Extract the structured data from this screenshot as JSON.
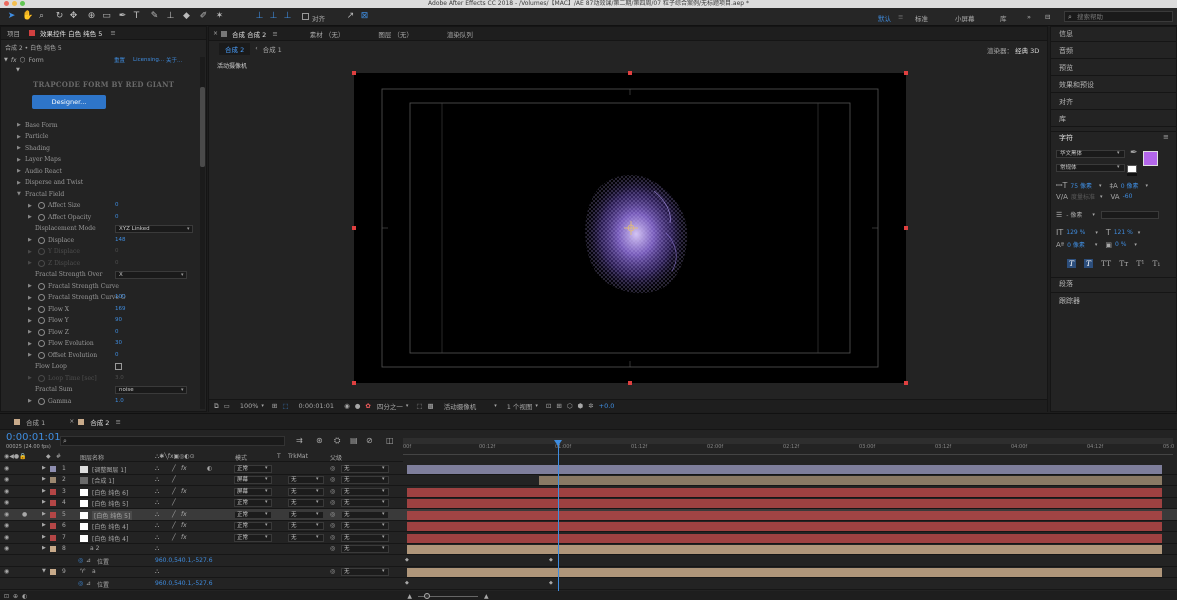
{
  "window_title": "Adobe After Effects CC 2018 - /Volumes/【MAC】/AE 87动效课/第二期/第四周/07 粒子综合案例/无标题项目.aep *",
  "toolbar": {
    "align_label": "对齐",
    "workspaces": [
      "默认",
      "标准",
      "小屏幕",
      "库"
    ],
    "search_placeholder": "搜索帮助"
  },
  "left_panel": {
    "tabs": [
      "项目",
      "效果控件 白色 纯色 5"
    ],
    "breadcrumb": "合成 2 • 白色 纯色 5",
    "effect_name": "Form",
    "effect_links": [
      "重置",
      "Licensing...",
      "关于..."
    ],
    "logo_text": "TRAPCODE FORM BY RED GIANT",
    "designer_button": "Designer...",
    "groups": [
      "Base Form",
      "Particle",
      "Shading",
      "Layer Maps",
      "Audio React",
      "Disperse and Twist",
      "Fractal Field"
    ],
    "params": [
      {
        "label": "Affect Size",
        "value": "0"
      },
      {
        "label": "Affect Opacity",
        "value": "0"
      },
      {
        "label": "Displacement Mode",
        "value": "XYZ Linked"
      },
      {
        "label": "Displace",
        "value": "148"
      },
      {
        "label": "Y Displace",
        "value": "0"
      },
      {
        "label": "Z Displace",
        "value": "0"
      },
      {
        "label": "Fractal Strength Over",
        "value": "X"
      },
      {
        "label": "Fractal Strength Curve",
        "value": ""
      },
      {
        "label": "Fractal Strength Curve O",
        "value": "100"
      },
      {
        "label": "Flow X",
        "value": "169"
      },
      {
        "label": "Flow Y",
        "value": "90"
      },
      {
        "label": "Flow Z",
        "value": "0"
      },
      {
        "label": "Flow Evolution",
        "value": "30"
      },
      {
        "label": "Offset Evolution",
        "value": "0"
      },
      {
        "label": "Flow Loop",
        "value": ""
      },
      {
        "label": "Loop Time [sec]",
        "value": "3.0"
      },
      {
        "label": "Fractal Sum",
        "value": "noise"
      },
      {
        "label": "Gamma",
        "value": "1.0"
      }
    ]
  },
  "comp_panel": {
    "tabs": [
      "合成 合成 2",
      "素材 （无）",
      "图层 （无）",
      "渲染队列"
    ],
    "breadcrumbs": [
      "合成 2",
      "合成 1"
    ],
    "renderer": "渲染器：",
    "renderer_value": "经典 3D",
    "camera_label": "活动摄像机",
    "footer": {
      "zoom": "100%",
      "timecode": "0:00:01:01",
      "resolution": "四分之一",
      "camera": "活动摄像机",
      "views": "1 个视图",
      "exposure": "+0.0"
    }
  },
  "right_panel": {
    "links": [
      "信息",
      "音频",
      "预览",
      "效果和预设",
      "对齐",
      "库"
    ],
    "char_title": "字符",
    "font_family": "华文黑体",
    "font_style": "常规体",
    "font_size": "75 像素",
    "leading": "0 像素",
    "kerning": "度量标准",
    "tracking": "-60",
    "stroke": "- 像素",
    "vscale": "129 %",
    "hscale": "121 %",
    "baseline": "0 像素",
    "tsume": "0 %",
    "text_styles": [
      "T",
      "T",
      "TT",
      "Tт",
      "T¹",
      "T₁"
    ],
    "bottom_links": [
      "段落",
      "跟踪器"
    ],
    "fill_color": "#b366ea"
  },
  "timeline": {
    "tabs": [
      "合成 1",
      "合成 2"
    ],
    "timecode": "0:00:01:01",
    "fps": "00025 (24.00 fps)",
    "headers": {
      "name": "图层名称",
      "mode": "模式",
      "t": "T",
      "trkmat": "TrkMat",
      "parent": "父级"
    },
    "ruler": [
      "00f",
      "00:12f",
      "01:00f",
      "01:12f",
      "02:00f",
      "02:12f",
      "03:00f",
      "03:12f",
      "04:00f",
      "04:12f",
      "05:0"
    ],
    "layers": [
      {
        "num": "1",
        "name": "[调整图层 1]",
        "mode": "正常",
        "trkmat": "",
        "parent": "无",
        "color": "#8e8eb0",
        "bar_start": 0.0
      },
      {
        "num": "2",
        "name": "[合成 1]",
        "mode": "屏幕",
        "trkmat": "无",
        "parent": "无",
        "color": "#9c8870",
        "bar_start": 0.175
      },
      {
        "num": "3",
        "name": "[白色 纯色 6]",
        "mode": "屏幕",
        "trkmat": "无",
        "parent": "无",
        "color": "#b44646",
        "bar_start": 0.0
      },
      {
        "num": "4",
        "name": "[白色 纯色 5]",
        "mode": "正常",
        "trkmat": "无",
        "parent": "无",
        "color": "#b44646",
        "bar_start": 0.0
      },
      {
        "num": "5",
        "name": "[白色 纯色 5]",
        "mode": "正常",
        "trkmat": "无",
        "parent": "无",
        "color": "#b44646",
        "bar_start": 0.0
      },
      {
        "num": "6",
        "name": "[白色 纯色 4]",
        "mode": "正常",
        "trkmat": "无",
        "parent": "无",
        "color": "#b44646",
        "bar_start": 0.0
      },
      {
        "num": "7",
        "name": "[白色 纯色 4]",
        "mode": "正常",
        "trkmat": "无",
        "parent": "无",
        "color": "#b44646",
        "bar_start": 0.0
      },
      {
        "num": "8",
        "name": "a 2",
        "mode": "",
        "trkmat": "",
        "parent": "无",
        "color": "#c8aa8a",
        "bar_start": 0.0
      }
    ],
    "sub1": {
      "label": "位置",
      "value": "960.0,540.1,-527.6"
    },
    "layer9": {
      "num": "9",
      "name": "a",
      "parent": "无"
    },
    "sub2": {
      "label": "位置",
      "value": "960.0,540.1,-527.6"
    },
    "playhead": 0.2
  }
}
